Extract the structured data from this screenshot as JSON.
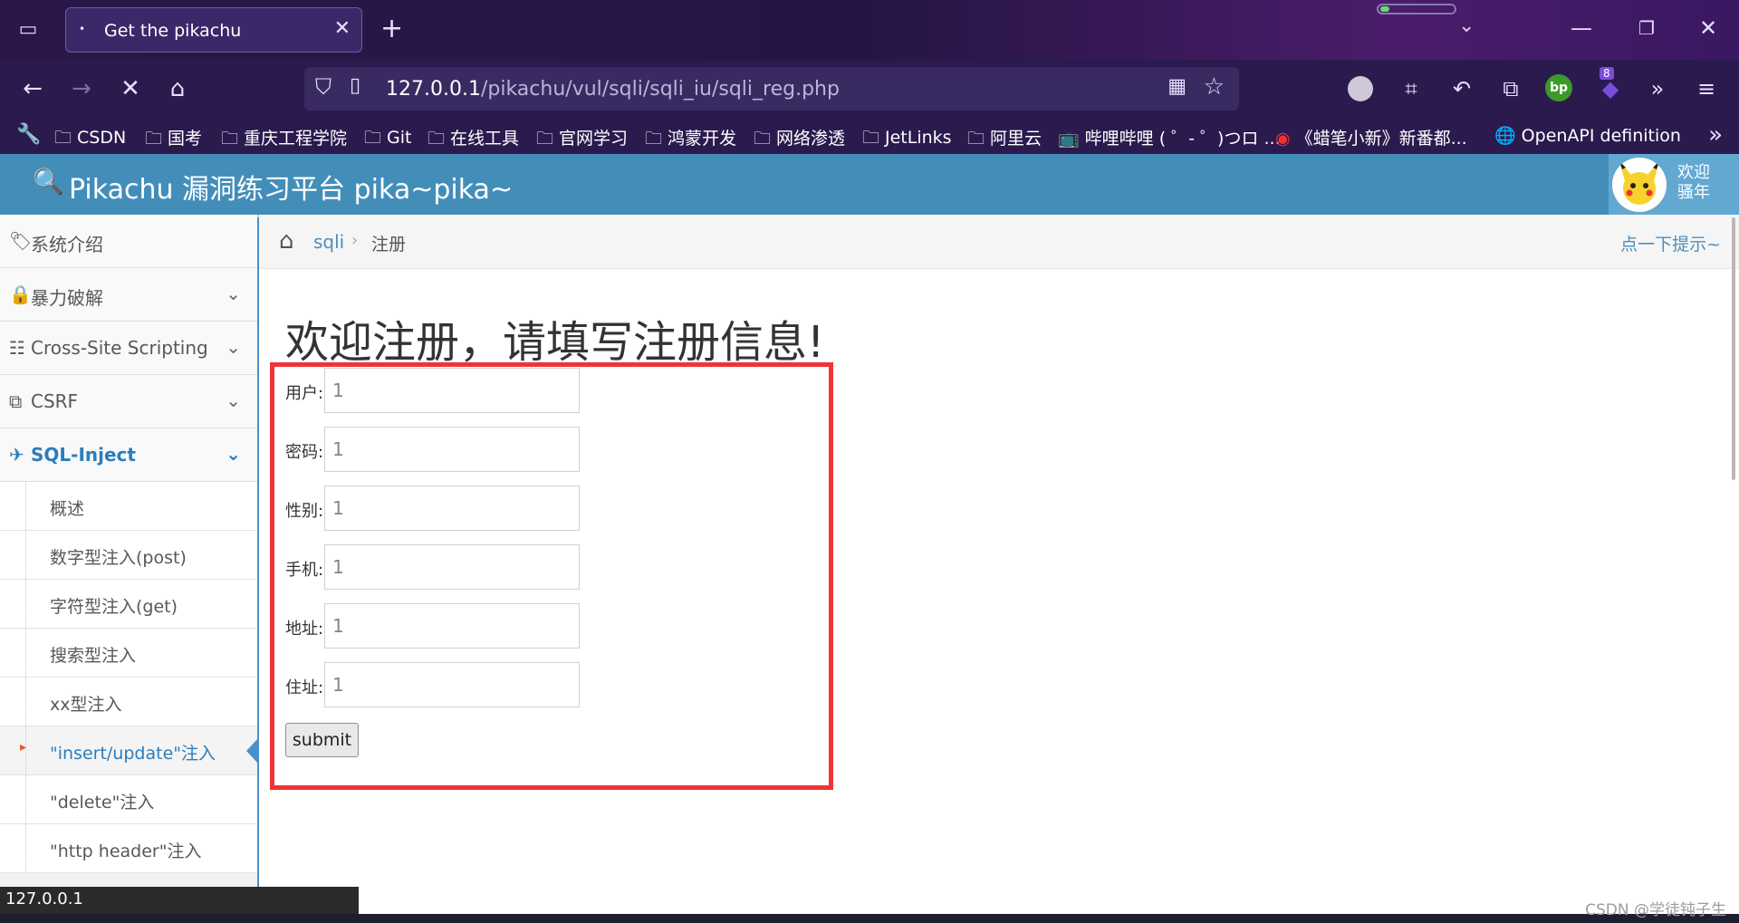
{
  "browser": {
    "tab": {
      "title": "Get the pikachu",
      "dot": "•",
      "close": "✕"
    },
    "new_tab": "+",
    "url": {
      "host": "127.0.0.1",
      "path": "/pikachu/vul/sqli/sqli_iu/sqli_reg.php"
    },
    "bookmarks": [
      "CSDN",
      "国考",
      "重庆工程学院",
      "Git",
      "在线工具",
      "官网学习",
      "鸿蒙开发",
      "网络渗透",
      "JetLinks",
      "阿里云",
      "哔哩哔哩 ( ゜- ゜)つロ ...",
      "《蜡笔小新》新番都...",
      "OpenAPI definition"
    ],
    "extension_badge": "8",
    "bp_label": "bp",
    "load_progress": 0.12
  },
  "site": {
    "title": "Pikachu 漏洞练习平台 pika~pika~",
    "welcome_line1": "欢迎",
    "welcome_line2": "骚年"
  },
  "sidebar": {
    "menu": [
      "系统介绍",
      "暴力破解",
      "Cross-Site Scripting",
      "CSRF",
      "SQL-Inject"
    ],
    "sub_items": [
      "概述",
      "数字型注入(post)",
      "字符型注入(get)",
      "搜索型注入",
      "xx型注入",
      "\"insert/update\"注入",
      "\"delete\"注入",
      "\"http header\"注入"
    ]
  },
  "breadcrumb": {
    "link": "sqli",
    "current": "注册",
    "hint": "点一下提示~"
  },
  "form": {
    "title": "欢迎注册，请填写注册信息!",
    "fields": [
      {
        "label": "用户:",
        "value": "1"
      },
      {
        "label": "密码:",
        "value": "1"
      },
      {
        "label": "性别:",
        "value": "1"
      },
      {
        "label": "手机:",
        "value": "1"
      },
      {
        "label": "地址:",
        "value": "1"
      },
      {
        "label": "住址:",
        "value": "1"
      }
    ],
    "submit": "submit"
  },
  "status": {
    "url": "127.0.0.1"
  },
  "watermark": "CSDN @学徒钝子生",
  "colors": {
    "highlight": "#f0333a",
    "header": "#438eb9",
    "accent": "#2b7dbc"
  }
}
